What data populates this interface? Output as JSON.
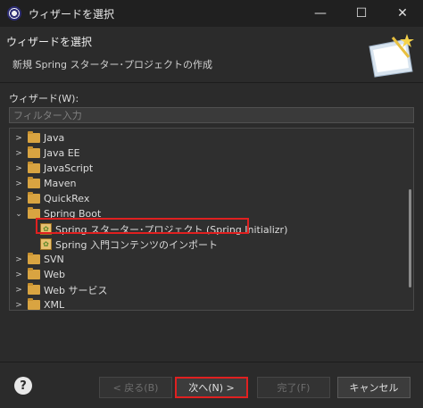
{
  "window": {
    "title": "ウィザードを選択",
    "minimize": "—",
    "maximize": "☐",
    "close": "✕"
  },
  "header": {
    "title": "ウィザードを選択",
    "description": "新規 Spring スターター･プロジェクトの作成"
  },
  "filter": {
    "label": "ウィザード(W):",
    "placeholder": "フィルター入力"
  },
  "tree": {
    "items": [
      {
        "label": "Java",
        "expanded": false
      },
      {
        "label": "Java EE",
        "expanded": false
      },
      {
        "label": "JavaScript",
        "expanded": false
      },
      {
        "label": "Maven",
        "expanded": false
      },
      {
        "label": "QuickRex",
        "expanded": false
      },
      {
        "label": "Spring Boot",
        "expanded": true
      },
      {
        "label": "Spring スターター･プロジェクト (Spring Initializr)",
        "child": true,
        "selected": true
      },
      {
        "label": "Spring 入門コンテンツのインポート",
        "child": true
      },
      {
        "label": "SVN",
        "expanded": false
      },
      {
        "label": "Web",
        "expanded": false
      },
      {
        "label": "Web サービス",
        "expanded": false
      },
      {
        "label": "XML",
        "expanded": false
      }
    ]
  },
  "buttons": {
    "help": "?",
    "back": "< 戻る(B)",
    "next": "次へ(N) >",
    "finish": "完了(F)",
    "cancel": "キャンセル"
  }
}
